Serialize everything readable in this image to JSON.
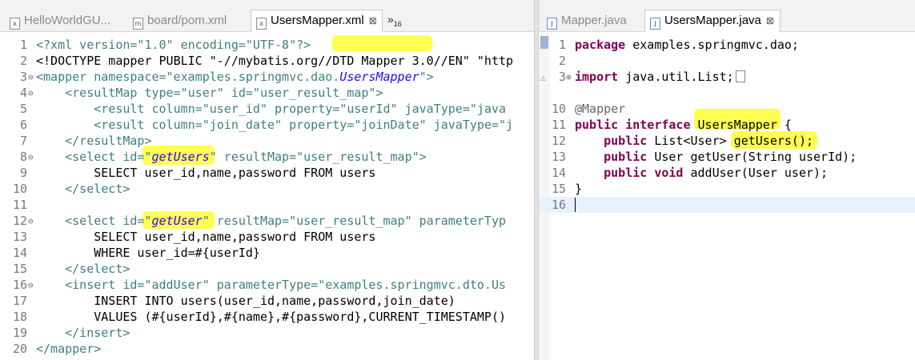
{
  "left": {
    "tabs": [
      {
        "label": "HelloWorldGU...",
        "icon": "xml-file-icon",
        "active": false
      },
      {
        "label": "board/pom.xml",
        "icon": "maven-file-icon",
        "active": false
      },
      {
        "label": "UsersMapper.xml",
        "icon": "xml-file-icon",
        "active": true
      }
    ],
    "close_glyph": "⊠",
    "overflow_label": "»",
    "overflow_count": "16",
    "lines": [
      {
        "n": "1",
        "t": [
          "<?xml version=\"1.0\" encoding=\"UTF-8\"?>"
        ]
      },
      {
        "n": "2",
        "t": [
          "<!DOCTYPE mapper PUBLIC \"-//mybatis.org//DTD Mapper 3.0//EN\" \"http"
        ]
      },
      {
        "n": "3",
        "t": [
          "<mapper namespace=\"examples.springmvc.dao.",
          "UsersMapper",
          "\">"
        ]
      },
      {
        "n": "4",
        "t": [
          "    <resultMap type=\"user\" id=\"user_result_map\">"
        ]
      },
      {
        "n": "5",
        "t": [
          "        <result column=\"user_id\" property=\"userId\" javaType=\"java"
        ]
      },
      {
        "n": "6",
        "t": [
          "        <result column=\"join_date\" property=\"joinDate\" javaType=\"j"
        ]
      },
      {
        "n": "7",
        "t": [
          "    </resultMap>"
        ]
      },
      {
        "n": "8",
        "t": [
          "    <select id=\"",
          "getUsers",
          "\" resultMap=\"user_result_map\">"
        ]
      },
      {
        "n": "9",
        "t": [
          "        SELECT user_id,name,password FROM users"
        ]
      },
      {
        "n": "10",
        "t": [
          "    </select>"
        ]
      },
      {
        "n": "11",
        "t": [
          ""
        ]
      },
      {
        "n": "12",
        "t": [
          "    <select id=\"",
          "getUser",
          "\" resultMap=\"user_result_map\" parameterTyp"
        ]
      },
      {
        "n": "13",
        "t": [
          "        SELECT user_id,name,password FROM users"
        ]
      },
      {
        "n": "14",
        "t": [
          "        WHERE user_id=#{userId}"
        ]
      },
      {
        "n": "15",
        "t": [
          "    </select>"
        ]
      },
      {
        "n": "16",
        "t": [
          "    <insert id=\"addUser\" parameterType=\"examples.springmvc.dto.Us"
        ]
      },
      {
        "n": "17",
        "t": [
          "        INSERT INTO users(user_id,name,password,join_date)"
        ]
      },
      {
        "n": "18",
        "t": [
          "        VALUES (#{userId},#{name},#{password},CURRENT_TIMESTAMP()"
        ]
      },
      {
        "n": "19",
        "t": [
          "    </insert>"
        ]
      },
      {
        "n": "20",
        "t": [
          "</mapper>"
        ]
      }
    ]
  },
  "right": {
    "tabs": [
      {
        "label": "Mapper.java",
        "icon": "java-file-icon",
        "active": false
      },
      {
        "label": "UsersMapper.java",
        "icon": "java-file-icon",
        "active": true
      }
    ],
    "close_glyph": "⊠",
    "lines": [
      {
        "n": "1",
        "t": [
          "package",
          " examples.springmvc.dao;"
        ]
      },
      {
        "n": "2",
        "t": [
          ""
        ]
      },
      {
        "n": "3",
        "t": [
          "import",
          " java.util.List;"
        ]
      },
      {
        "n": "10",
        "t": [
          "@Mapper"
        ]
      },
      {
        "n": "11",
        "t": [
          "public",
          " ",
          "interface",
          " ",
          "UsersMapper",
          " {"
        ]
      },
      {
        "n": "12",
        "t": [
          "    ",
          "public",
          " List<User> ",
          "getUsers();"
        ]
      },
      {
        "n": "13",
        "t": [
          "    ",
          "public",
          " User getUser(String userId);"
        ]
      },
      {
        "n": "14",
        "t": [
          "    ",
          "public",
          " ",
          "void",
          " addUser(User user);"
        ]
      },
      {
        "n": "15",
        "t": [
          "}"
        ]
      },
      {
        "n": "16",
        "t": [
          ""
        ]
      }
    ]
  },
  "colors": {
    "keyword": "#7f0055",
    "string": "#2a00ff",
    "highlight": "#ffff00",
    "line_number": "#7a7a7a"
  }
}
